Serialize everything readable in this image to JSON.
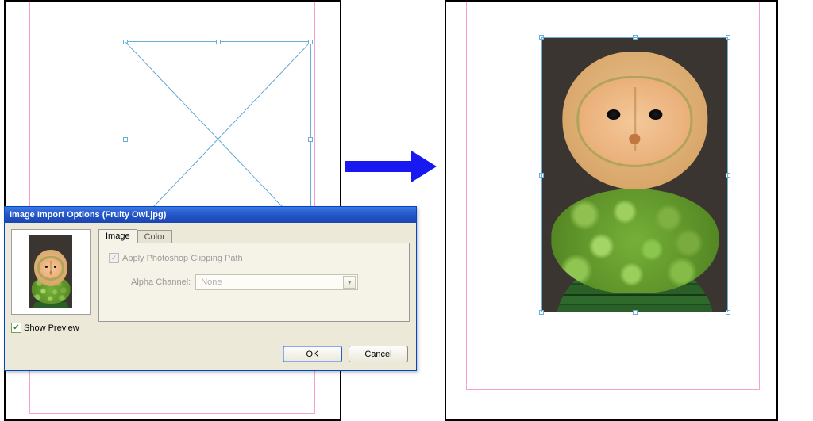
{
  "dialog": {
    "title": "Image Import Options (Fruity Owl.jpg)",
    "tabs": {
      "image": "Image",
      "color": "Color"
    },
    "apply_clipping_label": "Apply Photoshop Clipping Path",
    "alpha_label": "Alpha Channel:",
    "alpha_value": "None",
    "show_preview_label": "Show Preview",
    "ok": "OK",
    "cancel": "Cancel"
  }
}
